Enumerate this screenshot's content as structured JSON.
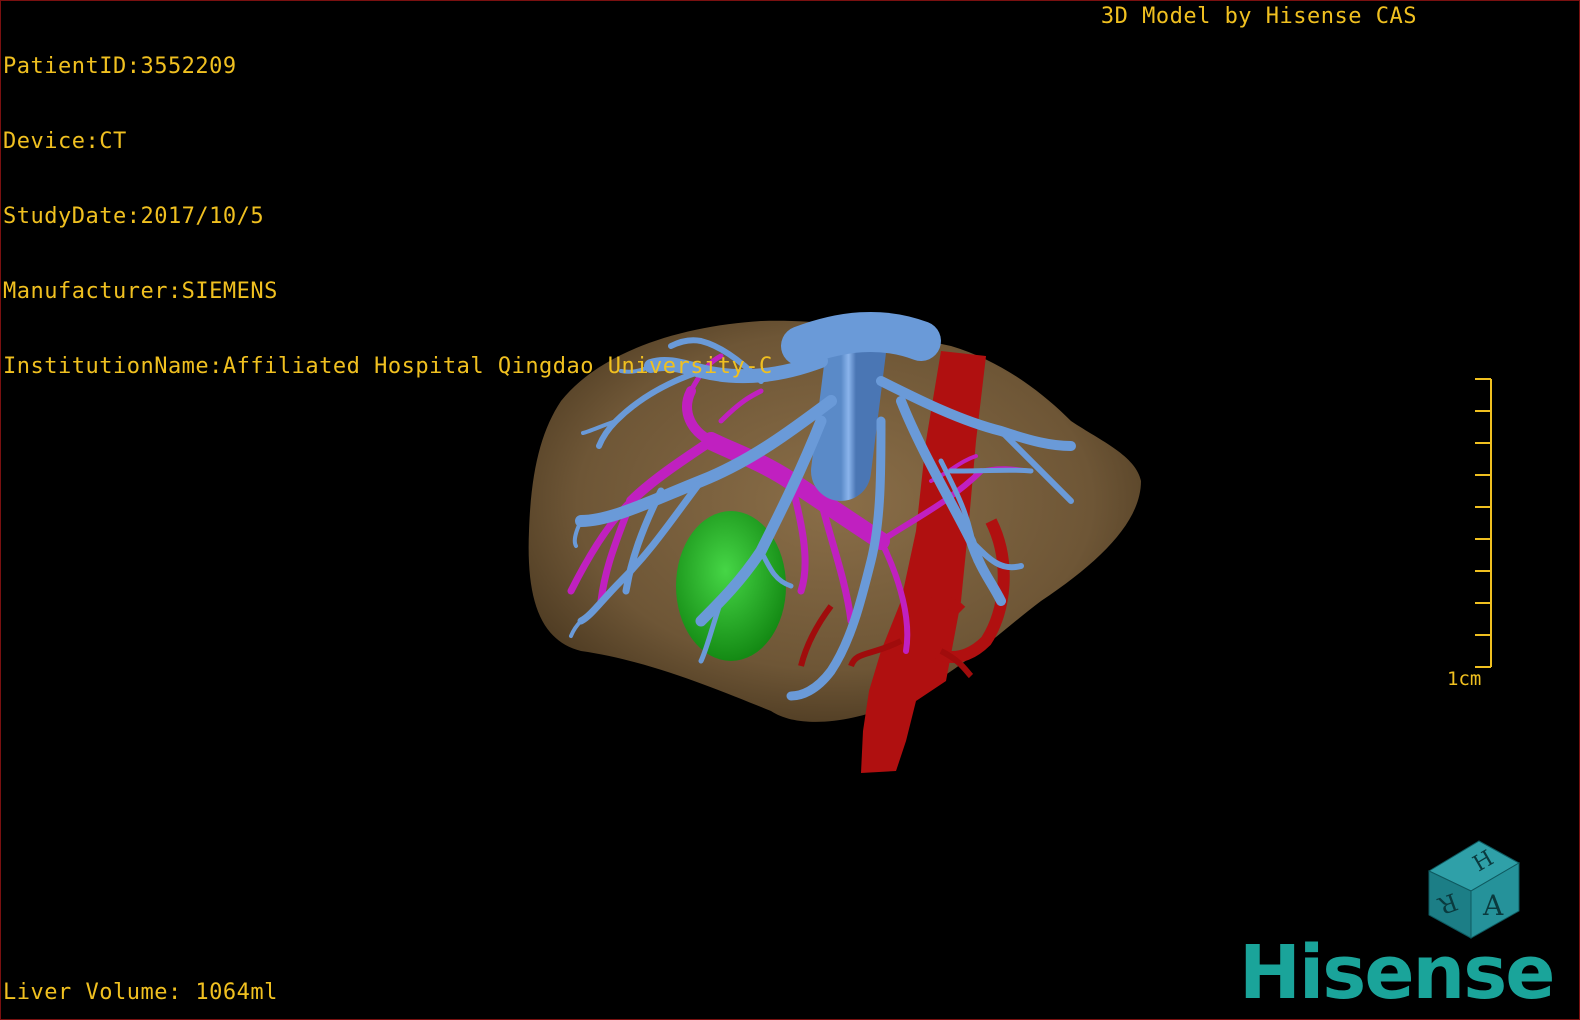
{
  "header": {
    "patient_id": "PatientID:3552209",
    "device": "Device:CT",
    "study_date": "StudyDate:2017/10/5",
    "manufacturer": "Manufacturer:SIEMENS",
    "institution": "InstitutionName:Affiliated Hospital Qingdao University-C",
    "model_credit": "3D Model by Hisense CAS"
  },
  "footer": {
    "liver_volume": "Liver Volume: 1064ml"
  },
  "scale_bar": {
    "label": "1cm"
  },
  "orientation_cube": {
    "face_front": "A",
    "face_top": "H",
    "face_side": "R"
  },
  "brand": {
    "logo_text": "Hisense",
    "logo_color": "#1aa49a"
  },
  "colors": {
    "overlay_text": "#f0c020",
    "liver": "#7a6040",
    "hepatic_vein": "#6a9ad8",
    "portal_vein": "#c020c0",
    "artery_ivc": "#b01010",
    "tumor": "#2aa82a",
    "border": "#7a1010"
  },
  "icons": [
    "orientation-cube-icon",
    "hisense-logo"
  ]
}
